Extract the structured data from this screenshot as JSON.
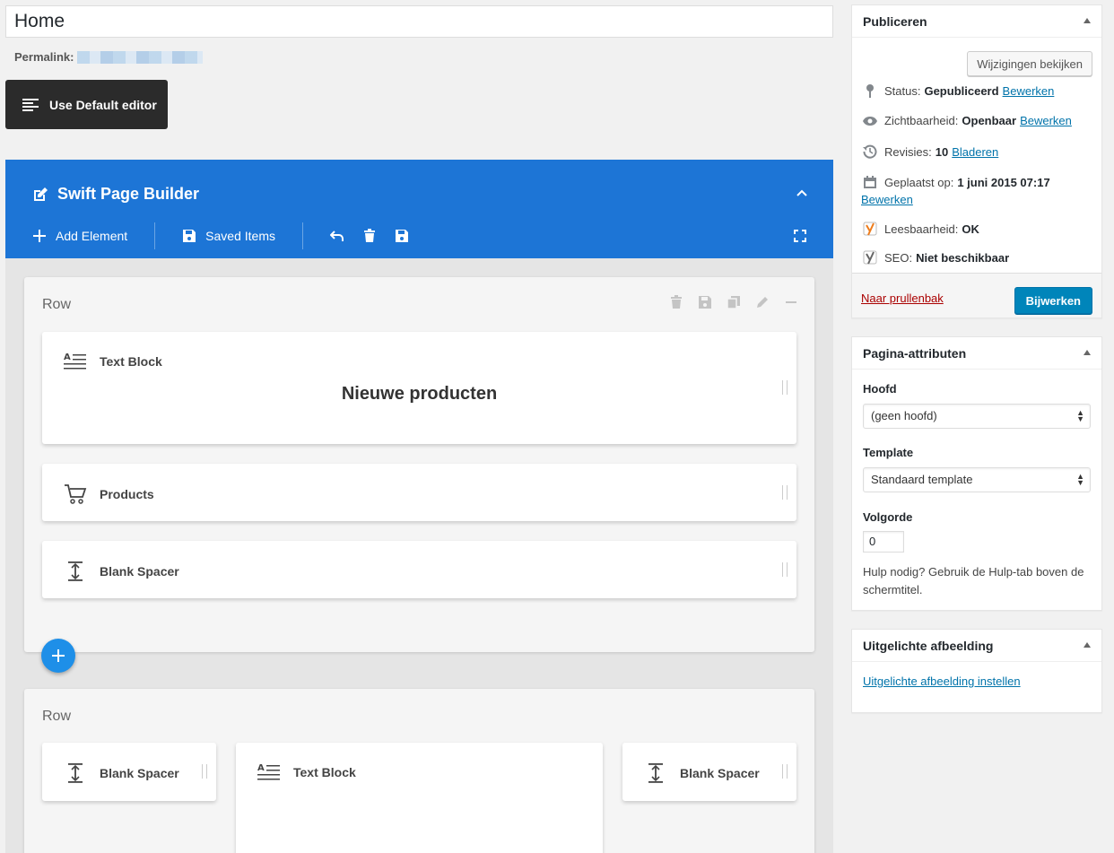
{
  "post": {
    "title": "Home",
    "permalink_label": "Permalink:"
  },
  "editor_toggle": {
    "label": "Use Default editor"
  },
  "builder": {
    "title": "Swift Page Builder",
    "toolbar": {
      "add_element": "Add Element",
      "saved_items": "Saved Items"
    },
    "accent_color": "#1d75d6",
    "rows": [
      {
        "label": "Row",
        "elements": [
          {
            "title": "Text Block",
            "content": "Nieuwe producten"
          },
          {
            "title": "Products"
          },
          {
            "title": "Blank Spacer"
          }
        ]
      },
      {
        "label": "Row",
        "elements": [
          {
            "title": "Blank Spacer"
          },
          {
            "title": "Text Block"
          },
          {
            "title": "Blank Spacer"
          }
        ]
      }
    ]
  },
  "publish": {
    "title": "Publiceren",
    "preview_button": "Wijzigingen bekijken",
    "status": {
      "label": "Status:",
      "value": "Gepubliceerd",
      "link": "Bewerken"
    },
    "visibility": {
      "label": "Zichtbaarheid:",
      "value": "Openbaar",
      "link": "Bewerken"
    },
    "revisions": {
      "label": "Revisies:",
      "value": "10",
      "link": "Bladeren"
    },
    "published_on": {
      "label": "Geplaatst op:",
      "value": "1 juni 2015 07:17",
      "link": "Bewerken"
    },
    "readability": {
      "label": "Leesbaarheid:",
      "value": "OK"
    },
    "seo": {
      "label": "SEO:",
      "value": "Niet beschikbaar"
    },
    "trash_link": "Naar prullenbak",
    "update_button": "Bijwerken"
  },
  "page_attributes": {
    "title": "Pagina-attributen",
    "parent_label": "Hoofd",
    "parent_value": "(geen hoofd)",
    "template_label": "Template",
    "template_value": "Standaard template",
    "order_label": "Volgorde",
    "order_value": "0",
    "help_text": "Hulp nodig? Gebruik de Hulp-tab boven de schermtitel."
  },
  "featured_image": {
    "title": "Uitgelichte afbeelding",
    "set_link": "Uitgelichte afbeelding instellen"
  }
}
